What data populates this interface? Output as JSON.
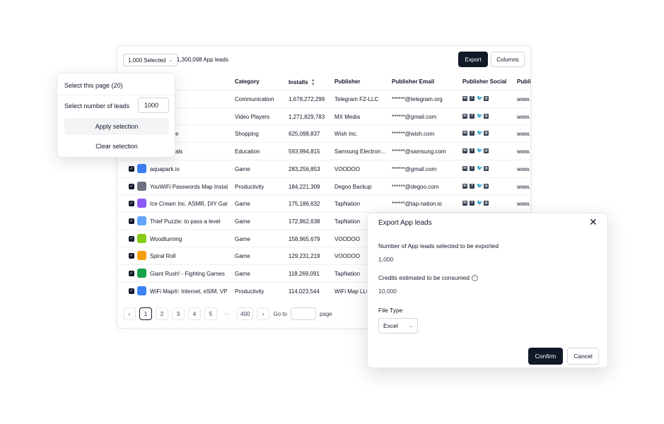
{
  "toolbar": {
    "selected_label": "1,000 Selected",
    "total_leads": "1,300,098 App leads",
    "export_label": "Export",
    "columns_label": "Columns"
  },
  "columns": {
    "category": "Category",
    "installs": "Installs",
    "publisher": "Publisher",
    "publisher_email": "Publisher Email",
    "publisher_social": "Publisher Social",
    "publisher_site": "Publis"
  },
  "rows": [
    {
      "name": "",
      "category": "Communication",
      "installs": "1,678,272,299",
      "publisher": "Telegram FZ-LLC",
      "email": "******@telegram.org",
      "site": "www.",
      "icon_color": "#2aa3e0"
    },
    {
      "name": "",
      "category": "Video Players",
      "installs": "1,271,829,783",
      "publisher": "MX Media",
      "email": "******@gmail.com",
      "site": "www.",
      "icon_color": "#1f6feb"
    },
    {
      "name": "p and Save",
      "category": "Shopping",
      "installs": "625,098,837",
      "publisher": "Wish Inc.",
      "email": "******@wish.com",
      "site": "www.",
      "icon_color": "#2fb7ec"
    },
    {
      "name": "Global Goals",
      "category": "Education",
      "installs": "593,994,815",
      "publisher": "Samsung Electron…",
      "email": "******@samsung.com",
      "site": "www.",
      "icon_color": "#1428a0"
    },
    {
      "name": "aquapark.io",
      "category": "Game",
      "installs": "283,256,853",
      "publisher": "VOODOO",
      "email": "******@gmail.com",
      "site": "www.",
      "icon_color": "#3b82f6"
    },
    {
      "name": "YouWiFi Passwords Map Instal",
      "category": "Productivity",
      "installs": "184,221,309",
      "publisher": "Degoo Backup",
      "email": "******@degoo.com",
      "site": "www.",
      "icon_color": "#6b7280"
    },
    {
      "name": "Ice Cream Inc. ASMR, DIY Gam",
      "category": "Game",
      "installs": "175,186,632",
      "publisher": "TapNation",
      "email": "******@tap-nation.io",
      "site": "www.",
      "icon_color": "#8b5cf6"
    },
    {
      "name": "Thief Puzzle: to pass a level",
      "category": "Game",
      "installs": "172,862,638",
      "publisher": "TapNation",
      "email": "",
      "site": "",
      "icon_color": "#60a5fa"
    },
    {
      "name": "Woodturning",
      "category": "Game",
      "installs": "158,965,679",
      "publisher": "VOODOO",
      "email": "",
      "site": "",
      "icon_color": "#84cc16"
    },
    {
      "name": "Spiral Roll",
      "category": "Game",
      "installs": "129,231,219",
      "publisher": "VOODOO",
      "email": "",
      "site": "",
      "icon_color": "#f59e0b"
    },
    {
      "name": "Giant Rush! - Fighting Games",
      "category": "Game",
      "installs": "118,269,091",
      "publisher": "TapNation",
      "email": "",
      "site": "",
      "icon_color": "#16a34a"
    },
    {
      "name": "WiFi Map®: Internet, eSIM, VPN",
      "category": "Productivity",
      "installs": "114,023,544",
      "publisher": "WiFi Map LLC",
      "email": "",
      "site": "",
      "icon_color": "#3b82f6"
    }
  ],
  "pagination": {
    "pages": [
      "1",
      "2",
      "3",
      "4",
      "5"
    ],
    "ellipsis": "···",
    "last_page": "400",
    "goto_label": "Go to",
    "page_label": "page"
  },
  "popover": {
    "select_page": "Select this page (20)",
    "select_number_label": "Select number of leads",
    "number_value": "1000",
    "apply_label": "Apply selection",
    "clear_label": "Clear selection"
  },
  "modal": {
    "title": "Export App leads",
    "leads_label": "Number of App leads selected to be exported",
    "leads_value": "1,000",
    "credits_label": "Credits estimated to be consumed",
    "credits_value": "10,000",
    "file_type_label": "File Type",
    "file_type_value": "Excel",
    "confirm_label": "Confirm",
    "cancel_label": "Cancel"
  }
}
